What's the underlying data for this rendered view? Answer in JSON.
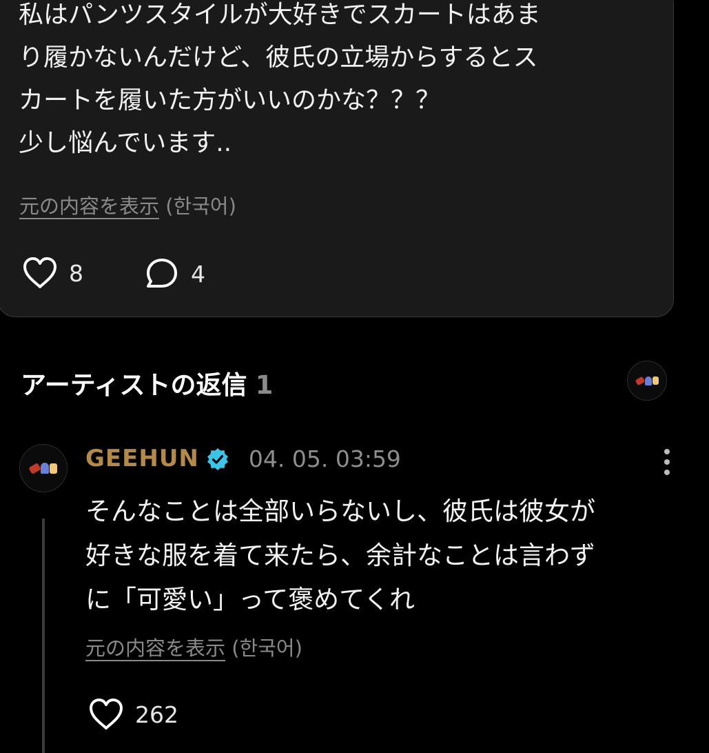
{
  "post": {
    "lines": [
      "私はパンツスタイルが大好きでスカートはあま",
      "り履かないんだけど、彼氏の立場からするとス",
      "カートを履いた方がいいのかな？？？",
      "少し悩んでいます.."
    ],
    "translate_link": "元の内容を表示",
    "translate_lang": "(한국어)",
    "like_count": "8",
    "comment_count": "4"
  },
  "section": {
    "title": "アーティストの返信",
    "count": "1"
  },
  "reply": {
    "author": "GEEHUN",
    "verified": true,
    "timestamp": "04. 05. 03:59",
    "lines": [
      "そんなことは全部いらないし、彼氏は彼女が",
      "好きな服を着て来たら、余計なことは言わず",
      "に「可愛い」って褒めてくれ"
    ],
    "translate_link": "元の内容を表示",
    "translate_lang": "(한국어)",
    "like_count": "262"
  },
  "icons": {
    "like": "heart-outline-icon",
    "comment": "speech-bubble-icon",
    "verified": "verified-badge-icon",
    "more": "more-vertical-icon",
    "avatar_emojis": [
      "guitar-emoji",
      "person-emoji",
      "rock-hand-emoji"
    ]
  },
  "colors": {
    "background": "#000000",
    "card": "#1a1a1a",
    "author": "#b38a4a",
    "verified": "#3cc4e6",
    "muted": "#8a8a8a"
  }
}
